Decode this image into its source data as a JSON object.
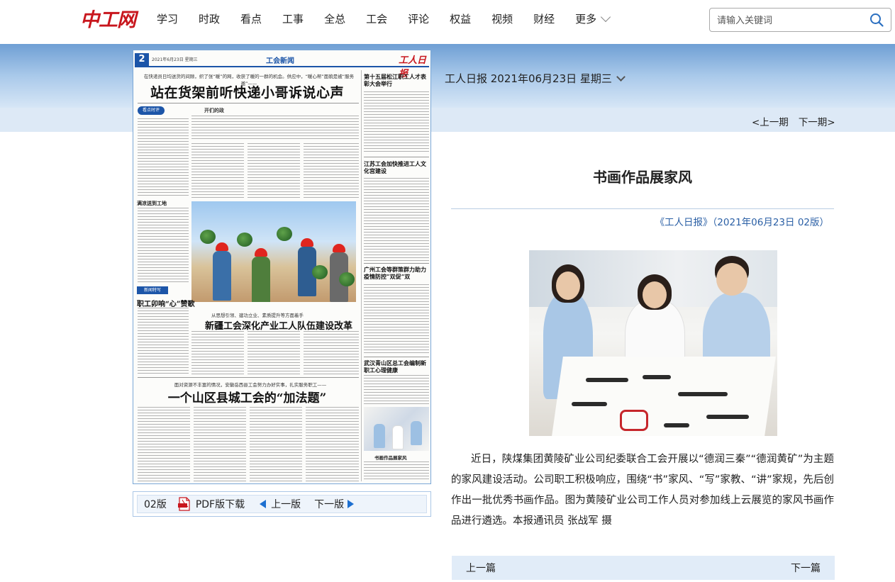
{
  "site": {
    "logo": "中工网",
    "nav": [
      "学习",
      "时政",
      "看点",
      "工事",
      "全总",
      "工会",
      "评论",
      "权益",
      "视频",
      "财经"
    ],
    "more_label": "更多",
    "search_placeholder": "请输入关键词"
  },
  "edition": {
    "date_label": "工人日报 2021年06月23日 星期三",
    "prev_issue": "<上一期",
    "next_issue": "下一期>"
  },
  "paper": {
    "page_num": "2",
    "page_date": "2021年6月23日 星期三",
    "section": "工会新闻",
    "brand": "工人日报",
    "lead1": "在快递员日均送货的间隙，织了张“暖”的网，收获了暖的一群的机会。供应中，“暖心帮”面貌是被“服务邀”——",
    "headline1": "站在货架前听快递小哥诉说心声",
    "tag1": "看点时评",
    "sub1": "开们的政",
    "sub2": "满凉送到工地",
    "tag2": "新闻特写",
    "headline_small": "职工卯响“心”赞歌",
    "lead2": "从思想引领、建功立业、素质提升等方面着手",
    "headline2": "新疆工会深化产业工人队伍建设改革",
    "lead3": "面对资源不丰富的情况，安徽岳西县工会努力办好实事，扎实服务职工——",
    "headline3": "一个山区县城工会的“加法题”",
    "right_heads": [
      "第十五届松江职工人才表彰大会举行",
      "江苏工会加快推进工人文化宫建设",
      "广州工会等群策群力助力 疫情防控“双促”双",
      "武汉青山区总工会编制新职工心理健康"
    ],
    "photo_caption": "书画作品展家风"
  },
  "paper_toolbar": {
    "version": "02版",
    "pdf_label": "PDF版下载",
    "prev_label": "上一版",
    "next_label": "下一版"
  },
  "article": {
    "title": "书画作品展家风",
    "source": "《工人日报》（2021年06月23日 02版）",
    "body": "近日，陕煤集团黄陵矿业公司纪委联合工会开展以“德润三秦”“德润黄矿”为主题的家风建设活动。公司职工积极响应，围绕“书”家风、“写”家教、“讲”家规，先后创作出一批优秀书画作品。图为黄陵矿业公司工作人员对参加线上云展览的家风书画作品进行遴选。本报通讯员 张战军 摄",
    "prev_article": "上一篇",
    "next_article": "下一篇"
  },
  "icons": {
    "search": "search-icon",
    "pdf": "pdf-icon",
    "prev": "triangle-left-icon",
    "next": "triangle-right-icon",
    "chevron": "chevron-down-icon"
  },
  "colors": {
    "brand_red": "#c8161d",
    "link_blue": "#2a5fa5",
    "band_blue": "#6f9fd4",
    "arrow_blue": "#1c6fd0"
  }
}
